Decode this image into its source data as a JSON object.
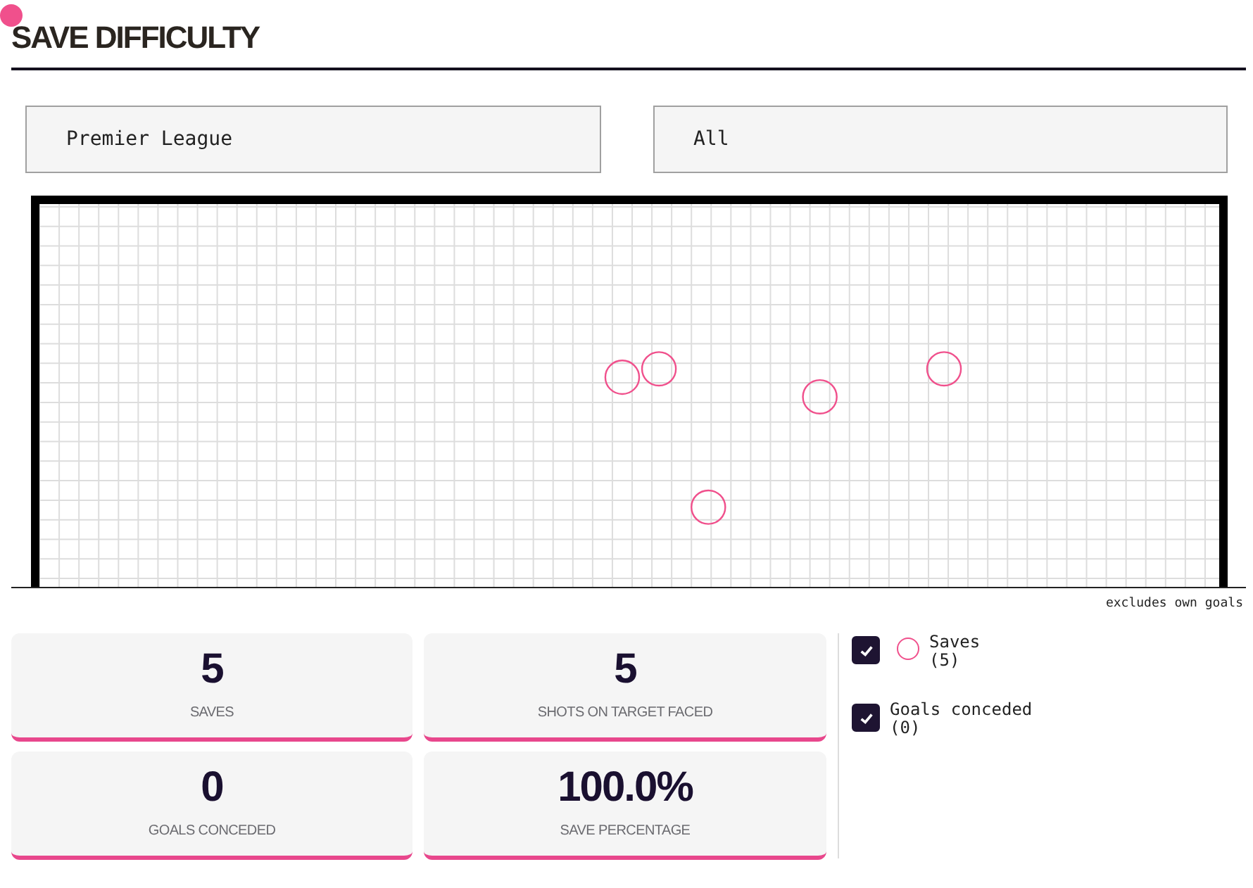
{
  "title": "SAVE DIFFICULTY",
  "filters": [
    {
      "value": "Premier League"
    },
    {
      "value": "All"
    }
  ],
  "shots": [
    {
      "kind": "save"
    },
    {
      "kind": "save"
    },
    {
      "kind": "save"
    },
    {
      "kind": "save"
    },
    {
      "kind": "save"
    }
  ],
  "note": "excludes own goals",
  "stats": [
    {
      "value": "5",
      "label": "SAVES"
    },
    {
      "value": "5",
      "label": "SHOTS ON TARGET FACED"
    },
    {
      "value": "0",
      "label": "GOALS CONCEDED"
    },
    {
      "value": "100.0%",
      "label": "SAVE PERCENTAGE"
    }
  ],
  "legend": [
    {
      "kind": "save",
      "label": "Saves",
      "count": "(5)",
      "checked": true
    },
    {
      "kind": "goal",
      "label": "Goals conceded",
      "count": "(0)",
      "checked": true
    }
  ]
}
